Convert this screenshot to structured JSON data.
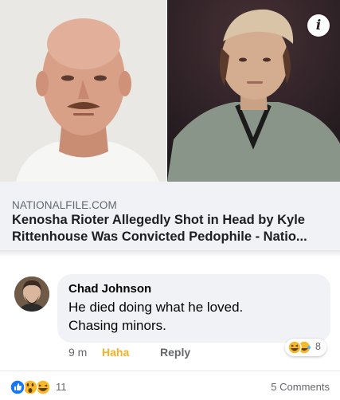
{
  "link_preview": {
    "domain": "NATIONALFILE.COM",
    "title_line1": "Kenosha Rioter Allegedly Shot in Head by Kyle",
    "title_line2": "Rittenhouse Was Convicted Pedophile - Natio...",
    "info_icon": "info-icon"
  },
  "comment": {
    "author": "Chad Johnson",
    "text_line1": "He died doing what he loved.",
    "text_line2": "Chasing minors.",
    "time": "9 m",
    "haha_label": "Haha",
    "reply_label": "Reply",
    "reaction_count": "8",
    "reaction_icons": [
      "haha-icon",
      "laugh-tears-icon"
    ]
  },
  "post_footer": {
    "reaction_icons": [
      "like-icon",
      "wow-icon",
      "haha-icon"
    ],
    "reaction_count": "11",
    "comments_label": "5 Comments"
  },
  "colors": {
    "haha_accent": "#f7b125",
    "like_blue": "#1877f2",
    "emoji_yellow": "#f7b928",
    "bubble_bg": "#f0f2f5"
  }
}
